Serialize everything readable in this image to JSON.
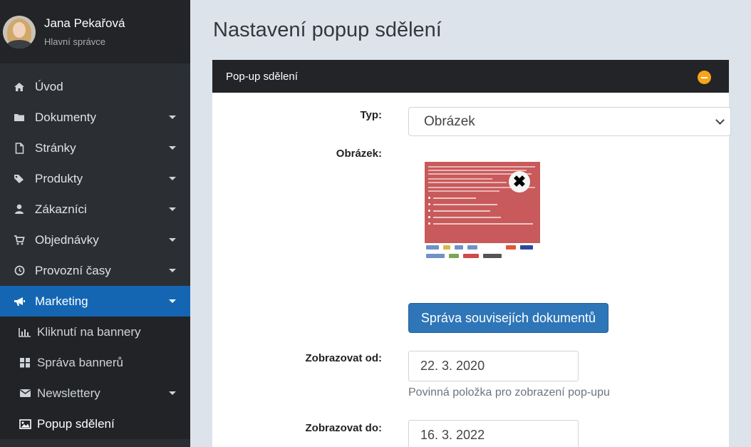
{
  "user": {
    "name": "Jana Pekařová",
    "role": "Hlavní správce"
  },
  "sidebar": {
    "items": [
      {
        "label": "Úvod",
        "icon": "home-icon"
      },
      {
        "label": "Dokumenty",
        "icon": "folder-icon"
      },
      {
        "label": "Stránky",
        "icon": "file-icon"
      },
      {
        "label": "Produkty",
        "icon": "tag-icon"
      },
      {
        "label": "Zákazníci",
        "icon": "user-icon"
      },
      {
        "label": "Objednávky",
        "icon": "cart-icon"
      },
      {
        "label": "Provozní časy",
        "icon": "clock-icon"
      },
      {
        "label": "Marketing",
        "icon": "megaphone-icon"
      }
    ],
    "submenu": [
      {
        "label": "Kliknutí na bannery",
        "icon": "bar-chart-icon"
      },
      {
        "label": "Správa bannerů",
        "icon": "grid-icon"
      },
      {
        "label": "Newslettery",
        "icon": "envelope-icon"
      },
      {
        "label": "Popup sdělení",
        "icon": "image-icon"
      }
    ],
    "active_color": "#1466b3"
  },
  "page": {
    "title": "Nastavení popup sdělení"
  },
  "panel": {
    "title": "Pop-up sdělení",
    "collapse_icon": "minus-circle-icon",
    "fields": {
      "type_label": "Typ:",
      "type_value": "Obrázek",
      "image_label": "Obrázek:",
      "docs_button": "Správa souvisejích dokumentů",
      "from_label": "Zobrazovat od:",
      "from_value": "22. 3. 2020",
      "from_help": "Povinná položka pro zobrazení pop-upu",
      "to_label": "Zobrazovat do:",
      "to_value": "16. 3. 2022"
    }
  },
  "thumbnail": {
    "remove_symbol": "✖",
    "line_widths": [
      150,
      138,
      145,
      90,
      110,
      150,
      100
    ],
    "bullet_widths": [
      60,
      90,
      80,
      95,
      140
    ]
  }
}
